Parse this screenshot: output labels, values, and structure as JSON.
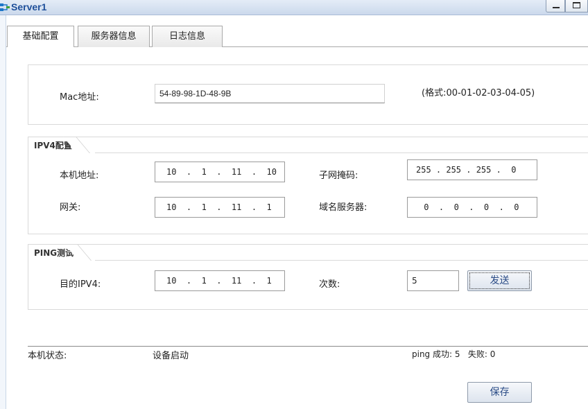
{
  "window": {
    "title": "Server1"
  },
  "tabs": [
    {
      "label": "基础配置"
    },
    {
      "label": "服务器信息"
    },
    {
      "label": "日志信息"
    }
  ],
  "mac": {
    "label": "Mac地址:",
    "value": "54-89-98-1D-48-9B",
    "hint": "(格式:00-01-02-03-04-05)"
  },
  "ipv4": {
    "legend": "IPV4配置",
    "local_label": "本机地址:",
    "local_value": "10  .  1  .  11  .  10",
    "mask_label": "子网掩码:",
    "mask_value": "255 . 255 . 255 .  0",
    "gateway_label": "网关:",
    "gateway_value": "10  .  1  .  11  .  1",
    "dns_label": "域名服务器:",
    "dns_value": " 0  .  0  .  0  .  0"
  },
  "ping": {
    "legend": "PING测试",
    "dest_label": "目的IPV4:",
    "dest_value": "10  .  1  .  11  .  1",
    "count_label": "次数:",
    "count_value": "5",
    "send_label": "发送"
  },
  "status": {
    "label": "本机状态:",
    "value": "设备启动",
    "ping_result": "ping 成功: 5   失败: 0"
  },
  "save_label": "保存",
  "colors": {
    "title": "#1e4f9a",
    "button_text": "#2a4b86"
  }
}
